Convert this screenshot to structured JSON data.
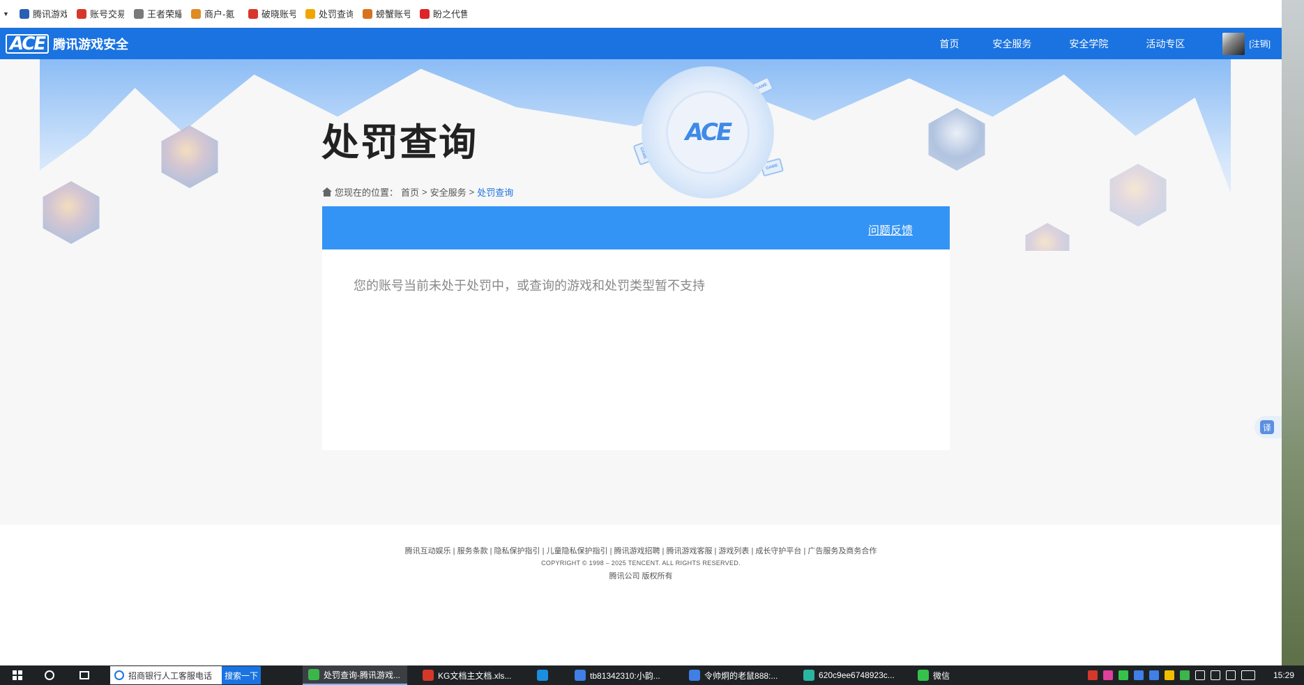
{
  "bookmarks": [
    {
      "label": "腾讯游戏",
      "icon": "shield-icon",
      "color": "#2b5fb4"
    },
    {
      "label": "账号交易",
      "icon": "cloud-icon",
      "color": "#d6372b"
    },
    {
      "label": "王者荣耀",
      "icon": "globe-icon",
      "color": "#7a7a7a"
    },
    {
      "label": "商户-氪",
      "icon": "chicken-icon",
      "color": "#e08a25"
    },
    {
      "label": "破晓账号",
      "icon": "cloud-icon",
      "color": "#d6372b"
    },
    {
      "label": "处罚查询",
      "icon": "flower-icon",
      "color": "#f0a600"
    },
    {
      "label": "螃蟹账号",
      "icon": "crab-icon",
      "color": "#d9721f"
    },
    {
      "label": "盼之代售",
      "icon": "bag-icon",
      "color": "#e0222a"
    }
  ],
  "nav": {
    "logo_mark": "ACE",
    "logo_text": "腾讯游戏安全",
    "links": [
      "首页",
      "安全服务",
      "安全学院",
      "活动专区"
    ],
    "login": "[注销]"
  },
  "hero": {
    "ace_mark": "ACE",
    "game_tile": "GAME"
  },
  "page": {
    "title": "处罚查询",
    "breadcrumb_prefix": "您现在的位置：",
    "breadcrumb": [
      "首页",
      "安全服务",
      "处罚查询"
    ],
    "separator": ">",
    "feedback": "问题反馈",
    "message": "您的账号当前未处于处罚中，或查询的游戏和处罚类型暂不支持"
  },
  "translate": "译",
  "footer": {
    "links": "腾讯互动娱乐 | 服务条款 | 隐私保护指引 | 儿童隐私保护指引 | 腾讯游戏招聘 | 腾讯游戏客服 | 游戏列表 | 成长守护平台 | 广告服务及商务合作",
    "copyright": "COPYRIGHT © 1998 – 2025 TENCENT. ALL RIGHTS RESERVED.",
    "company": "腾讯公司 版权所有"
  },
  "taskbar": {
    "search_text": "招商银行人工客服电话",
    "search_button": "搜索一下",
    "apps": [
      {
        "label": "处罚查询-腾讯游戏...",
        "color": "#3cb54a",
        "active": true
      },
      {
        "label": "KG文档主文档.xls...",
        "color": "#d6372b",
        "active": false
      },
      {
        "label": "",
        "color": "#1a8fe0",
        "active": false
      },
      {
        "label": "tb81342310:小韵...",
        "color": "#3f7fe6",
        "active": false
      },
      {
        "label": "令帅炯的老鼠888:...",
        "color": "#3f7fe6",
        "active": false
      },
      {
        "label": "620c9ee6748923c...",
        "color": "#2ab5a0",
        "active": false
      },
      {
        "label": "微信",
        "color": "#35c24a",
        "active": false
      }
    ],
    "clock": "15:29"
  }
}
